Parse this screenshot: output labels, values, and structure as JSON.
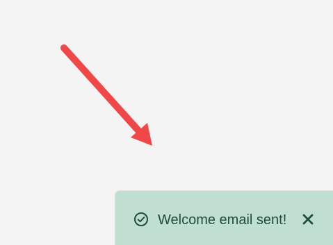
{
  "toast": {
    "message": "Welcome email sent!",
    "status_icon": "check-circle-icon",
    "close_icon": "close-icon"
  },
  "annotation": {
    "icon": "red-arrow-icon"
  },
  "colors": {
    "background": "#f4f4f4",
    "toast_background": "#c0dfd0",
    "toast_text": "#1f4d3c",
    "annotation_arrow": "#f04848"
  }
}
